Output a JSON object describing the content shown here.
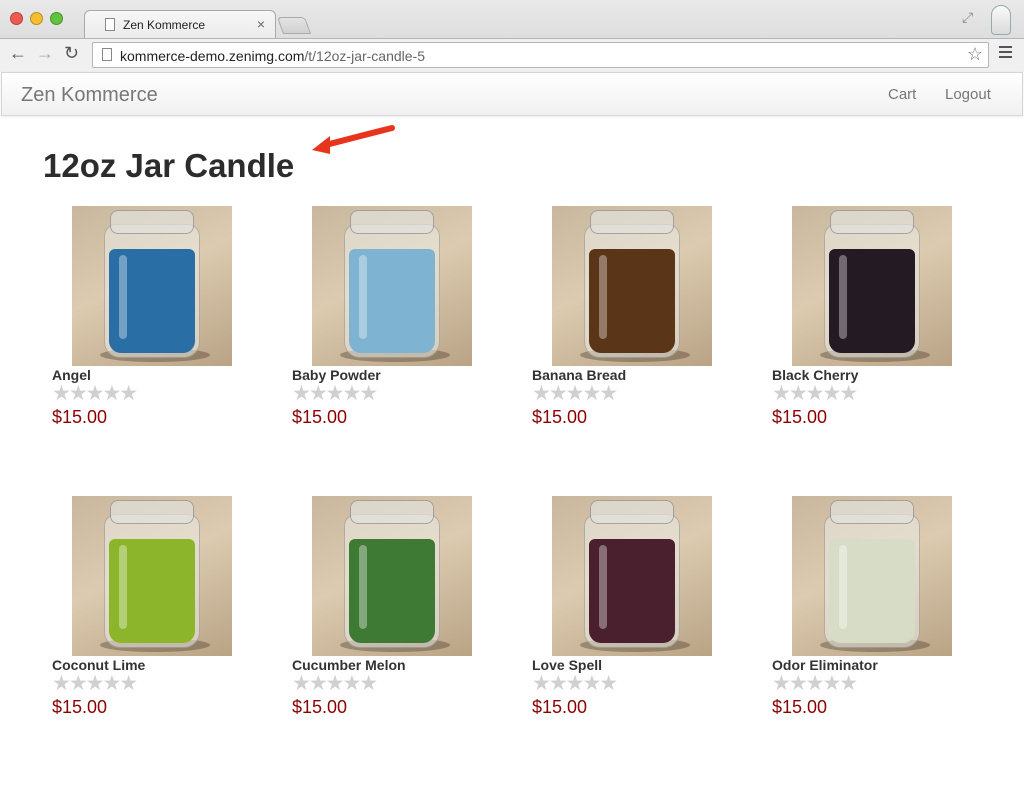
{
  "browser": {
    "tab_title": "Zen Kommerce",
    "url_host": "kommerce-demo.zenimg.com",
    "url_path": "/t/12oz-jar-candle-5"
  },
  "site": {
    "brand": "Zen Kommerce",
    "nav": {
      "cart": "Cart",
      "logout": "Logout"
    }
  },
  "page": {
    "title": "12oz Jar Candle"
  },
  "rating_glyphs": "★★★★★",
  "products": [
    {
      "name": "Angel",
      "price": "$15.00",
      "wax_color": "#2a6ea6"
    },
    {
      "name": "Baby Powder",
      "price": "$15.00",
      "wax_color": "#7fb3d2"
    },
    {
      "name": "Banana Bread",
      "price": "$15.00",
      "wax_color": "#5a3518"
    },
    {
      "name": "Black Cherry",
      "price": "$15.00",
      "wax_color": "#241a24"
    },
    {
      "name": "Coconut Lime",
      "price": "$15.00",
      "wax_color": "#8db52c"
    },
    {
      "name": "Cucumber Melon",
      "price": "$15.00",
      "wax_color": "#3f7a35"
    },
    {
      "name": "Love Spell",
      "price": "$15.00",
      "wax_color": "#4a1f2e"
    },
    {
      "name": "Odor Eliminator",
      "price": "$15.00",
      "wax_color": "#d7dcc7"
    }
  ],
  "colors": {
    "price": "#8b0000",
    "arrow": "#e8341c"
  }
}
